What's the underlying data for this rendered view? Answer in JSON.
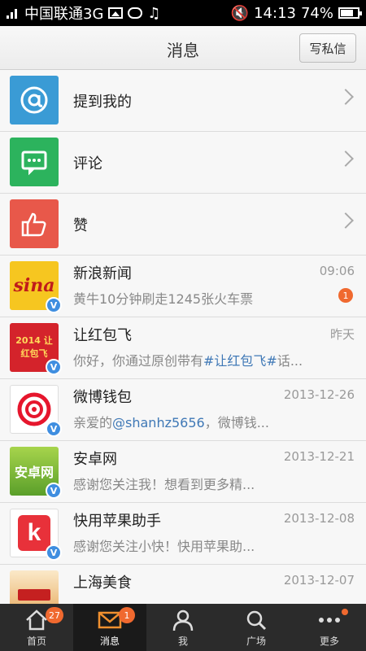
{
  "status_bar": {
    "carrier": "中国联通3G",
    "time": "14:13",
    "battery": "74%"
  },
  "header": {
    "title": "消息",
    "write_button": "写私信"
  },
  "categories": [
    {
      "label": "提到我的",
      "icon": "at-icon",
      "color": "#3a9bd5"
    },
    {
      "label": "评论",
      "icon": "comment-icon",
      "color": "#2cb35d"
    },
    {
      "label": "赞",
      "icon": "thumbs-up-icon",
      "color": "#e8584a"
    }
  ],
  "messages": [
    {
      "name": "新浪新闻",
      "time": "09:06",
      "preview": "黄牛10分钟刷走1245张火车票",
      "unread": "1",
      "avatar_text": "sina"
    },
    {
      "name": "让红包飞",
      "time": "昨天",
      "preview_parts": [
        "你好，你通过原创带有",
        "#让红包飞#",
        "话..."
      ],
      "avatar_text": "2014 让红包飞"
    },
    {
      "name": "微博钱包",
      "time": "2013-12-26",
      "preview_parts": [
        "亲爱的",
        "@shanhz5656",
        "，微博钱..."
      ]
    },
    {
      "name": "安卓网",
      "time": "2013-12-21",
      "preview": "感谢您关注我！想看到更多精...",
      "avatar_text": "安卓网"
    },
    {
      "name": "快用苹果助手",
      "time": "2013-12-08",
      "preview": "感谢您关注小快！快用苹果助...",
      "avatar_text": "k"
    },
    {
      "name": "上海美食",
      "time": "2013-12-07",
      "preview": ""
    }
  ],
  "tabbar": [
    {
      "label": "首页",
      "badge": "27"
    },
    {
      "label": "消息",
      "badge": "1",
      "active": true
    },
    {
      "label": "我"
    },
    {
      "label": "广场"
    },
    {
      "label": "更多",
      "dot": true
    }
  ]
}
